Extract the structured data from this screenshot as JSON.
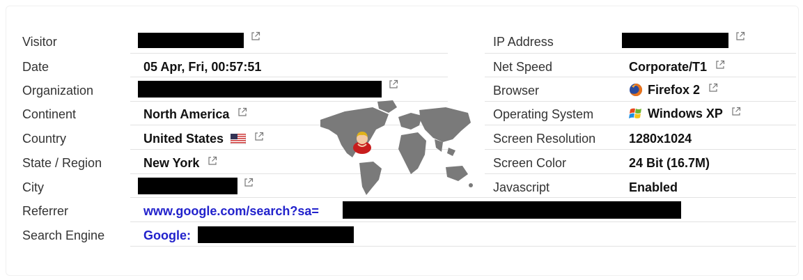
{
  "left_rows": [
    {
      "label": "Visitor"
    },
    {
      "label": "Date",
      "value": "05 Apr, Fri, 00:57:51"
    },
    {
      "label": "Organization"
    },
    {
      "label": "Continent",
      "value": "North America"
    },
    {
      "label": "Country",
      "value": "United States"
    },
    {
      "label": "State / Region",
      "value": "New York"
    },
    {
      "label": "City"
    },
    {
      "label": "Referrer",
      "value": "www.google.com/search?sa="
    },
    {
      "label": "Search Engine",
      "value": "Google:"
    }
  ],
  "right_rows": [
    {
      "label": "IP Address"
    },
    {
      "label": "Net Speed",
      "value": "Corporate/T1"
    },
    {
      "label": "Browser",
      "value": "Firefox 2"
    },
    {
      "label": "Operating System",
      "value": "Windows XP"
    },
    {
      "label": "Screen Resolution",
      "value": "1280x1024"
    },
    {
      "label": "Screen Color",
      "value": "24 Bit (16.7M)"
    },
    {
      "label": "Javascript",
      "value": "Enabled"
    }
  ],
  "icons": {
    "external_link": "external-link-icon",
    "flag": "us-flag-icon",
    "browser": "firefox-icon",
    "os": "windows-icon",
    "map": "world-map",
    "map_marker": "visitor-avatar-icon"
  },
  "colors": {
    "link": "#2222cc",
    "divider": "#e2e2e2",
    "map": "#7a7a7a",
    "redaction": "#000000"
  }
}
